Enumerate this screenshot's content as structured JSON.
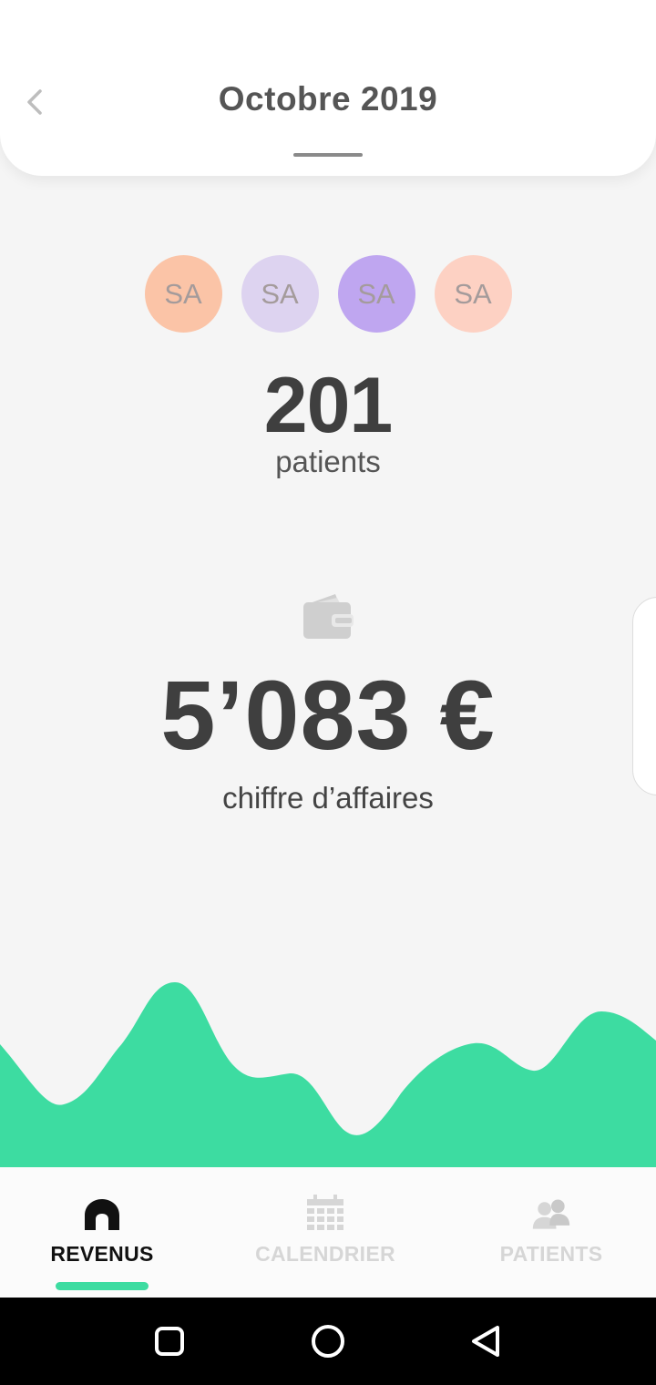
{
  "header": {
    "title": "Octobre 2019",
    "back_icon": "chevron-left-icon"
  },
  "avatars": [
    {
      "initials": "SA",
      "color": "#fbc4a7"
    },
    {
      "initials": "SA",
      "color": "#ddd3f0"
    },
    {
      "initials": "SA",
      "color": "#bfa6f0"
    },
    {
      "initials": "SA",
      "color": "#fdd1c3"
    }
  ],
  "stats": {
    "patient_count": "201",
    "patient_label": "patients",
    "revenue_icon": "wallet-icon",
    "revenue_amount": "5’083 €",
    "revenue_label": "chiffre d’affaires"
  },
  "chart": {
    "accent_color": "#3ddca1"
  },
  "bottom_nav": {
    "items": [
      {
        "label": "REVENUS",
        "icon": "home-icon",
        "active": true
      },
      {
        "label": "CALENDRIER",
        "icon": "calendar-icon",
        "active": false
      },
      {
        "label": "PATIENTS",
        "icon": "users-icon",
        "active": false
      }
    ]
  },
  "system_nav": {
    "icons": [
      "recents-icon",
      "home-circle-icon",
      "back-triangle-icon"
    ]
  }
}
